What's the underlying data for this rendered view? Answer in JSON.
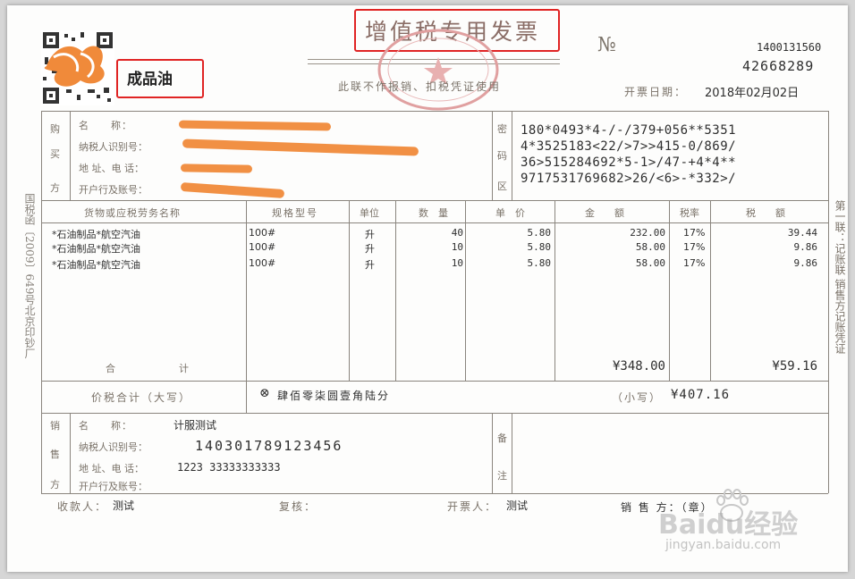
{
  "header": {
    "product_tag": "成品油",
    "title": "增值税专用发票",
    "no_symbol": "№",
    "invoice_code": "1400131560",
    "invoice_number": "42668289",
    "notice": "此联不作报销、扣税凭证使用",
    "date_label": "开票日期：",
    "date_value": "2018年02月02日"
  },
  "side": {
    "left_note": "国税函〔2009〕649号北京印钞厂",
    "right_note": "第一联：记账联 销售方记账凭证"
  },
  "buyer": {
    "section_label": [
      "购",
      "买",
      "方"
    ],
    "name_label": "名　　称：",
    "tax_id_label": "纳税人识别号：",
    "address_label": "地 址、电 话：",
    "bank_label": "开户行及账号："
  },
  "cipher": {
    "section_label": [
      "密",
      "码",
      "区"
    ],
    "lines": [
      "180*0493*4-/-/379+056**5351",
      "4*3525183<22/>7>>415-0/869/",
      "36>515284692*5-1>/47-+4*4**",
      "9717531769682>26/<6>-*332>/"
    ]
  },
  "table": {
    "headers": [
      "货物或应税劳务名称",
      "规格型号",
      "单位",
      "数　量",
      "单　价",
      "金　　额",
      "税率",
      "税　　额"
    ],
    "rows": [
      {
        "name": "*石油制品*航空汽油",
        "spec": "100#",
        "unit": "升",
        "qty": "40",
        "price": "5.80",
        "amount": "232.00",
        "rate": "17%",
        "tax": "39.44"
      },
      {
        "name": "*石油制品*航空汽油",
        "spec": "100#",
        "unit": "升",
        "qty": "10",
        "price": "5.80",
        "amount": "58.00",
        "rate": "17%",
        "tax": "9.86"
      },
      {
        "name": "*石油制品*航空汽油",
        "spec": "100#",
        "unit": "升",
        "qty": "10",
        "price": "5.80",
        "amount": "58.00",
        "rate": "17%",
        "tax": "9.86"
      }
    ],
    "total_label_1": "合",
    "total_label_2": "计",
    "total_amount": "¥348.00",
    "total_tax": "¥59.16"
  },
  "grand_total": {
    "label": "价税合计（大写）",
    "words": "肆佰零柒圆壹角陆分",
    "small_label": "（小写）",
    "small_value": "¥407.16"
  },
  "seller": {
    "section_label": [
      "销",
      "售",
      "方"
    ],
    "name_label": "名　　称：",
    "name_value": "计服测试",
    "tax_id_label": "纳税人识别号：",
    "tax_id_value": "140301789123456",
    "address_label": "地 址、电 话：",
    "address_value": "1223 33333333333",
    "bank_label": "开户行及账号：",
    "remarks_label": [
      "备",
      "注"
    ]
  },
  "footer": {
    "payee_label": "收款人：",
    "payee_value": "测试",
    "review_label": "复核：",
    "drawer_label": "开票人：",
    "drawer_value": "测试",
    "seller_label": "销 售 方：（章）"
  },
  "watermark": {
    "brand": "Baidu经验",
    "url": "jingyan.baidu.com"
  },
  "colors": {
    "highlight": "#e02424",
    "redaction": "#f08a3a",
    "seal": "#e0a0a0"
  }
}
